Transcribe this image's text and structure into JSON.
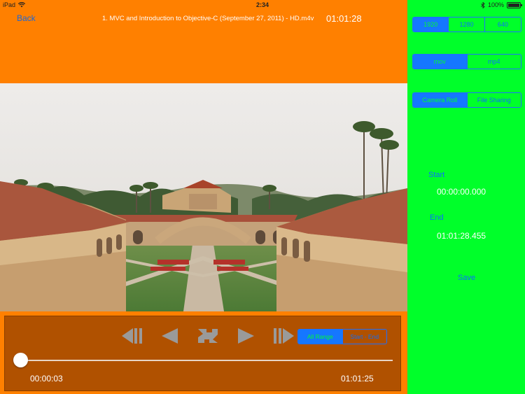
{
  "status_bar": {
    "device": "iPad",
    "time": "2:34",
    "battery": "100%",
    "battery_level": 1.0
  },
  "header": {
    "back_label": "Back",
    "file_title": "1. MVC and Introduction to Objective-C (September 27, 2011) - HD.m4v",
    "duration": "01:01:28"
  },
  "player": {
    "range_options": [
      "All Range",
      "Start - End"
    ],
    "range_selected": "All Range",
    "current_time": "00:00:03",
    "remaining_time": "01:01:25",
    "progress": 0.0008
  },
  "settings": {
    "resolutions": [
      "1920",
      "1280",
      "640"
    ],
    "resolution_selected": "1920",
    "formats": [
      "mov",
      "mp4"
    ],
    "format_selected": "mov",
    "destinations": [
      "Camera Roll",
      "File Sharing"
    ],
    "destination_selected": "Camera Roll",
    "start_label": "Start",
    "start_value": "00:00:00.000",
    "end_label": "End",
    "end_value": "01:01:28.455",
    "save_label": "Save"
  },
  "colors": {
    "accent": "#1577ff",
    "left_bg": "#ff8000",
    "right_bg": "#00ff2a",
    "controls_bg": "#b05100"
  }
}
